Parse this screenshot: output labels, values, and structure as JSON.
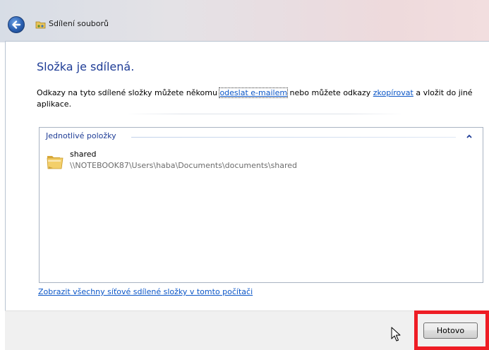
{
  "window": {
    "title": "Sdílení souborů"
  },
  "main": {
    "heading": "Složka je sdílená.",
    "desc_part1": "Odkazy na tyto sdílené složky můžete někomu ",
    "link_email": "odeslat e-mailem",
    "desc_part2": " nebo můžete odkazy ",
    "link_copy": "zkopírovat",
    "desc_part3": " a vložit do jiné aplikace.",
    "group_header": "Jednotlivé položky",
    "items": [
      {
        "name": "shared",
        "path": "\\\\NOTEBOOK87\\Users\\haba\\Documents\\documents\\shared",
        "icon": "folder-icon"
      }
    ],
    "show_all_link": "Zobrazit všechny síťové sdílené složky v tomto počítači"
  },
  "footer": {
    "done_label": "Hotovo"
  },
  "colors": {
    "heading": "#1e3c96",
    "link": "#0b56c7",
    "highlight": "#ee1c24"
  }
}
